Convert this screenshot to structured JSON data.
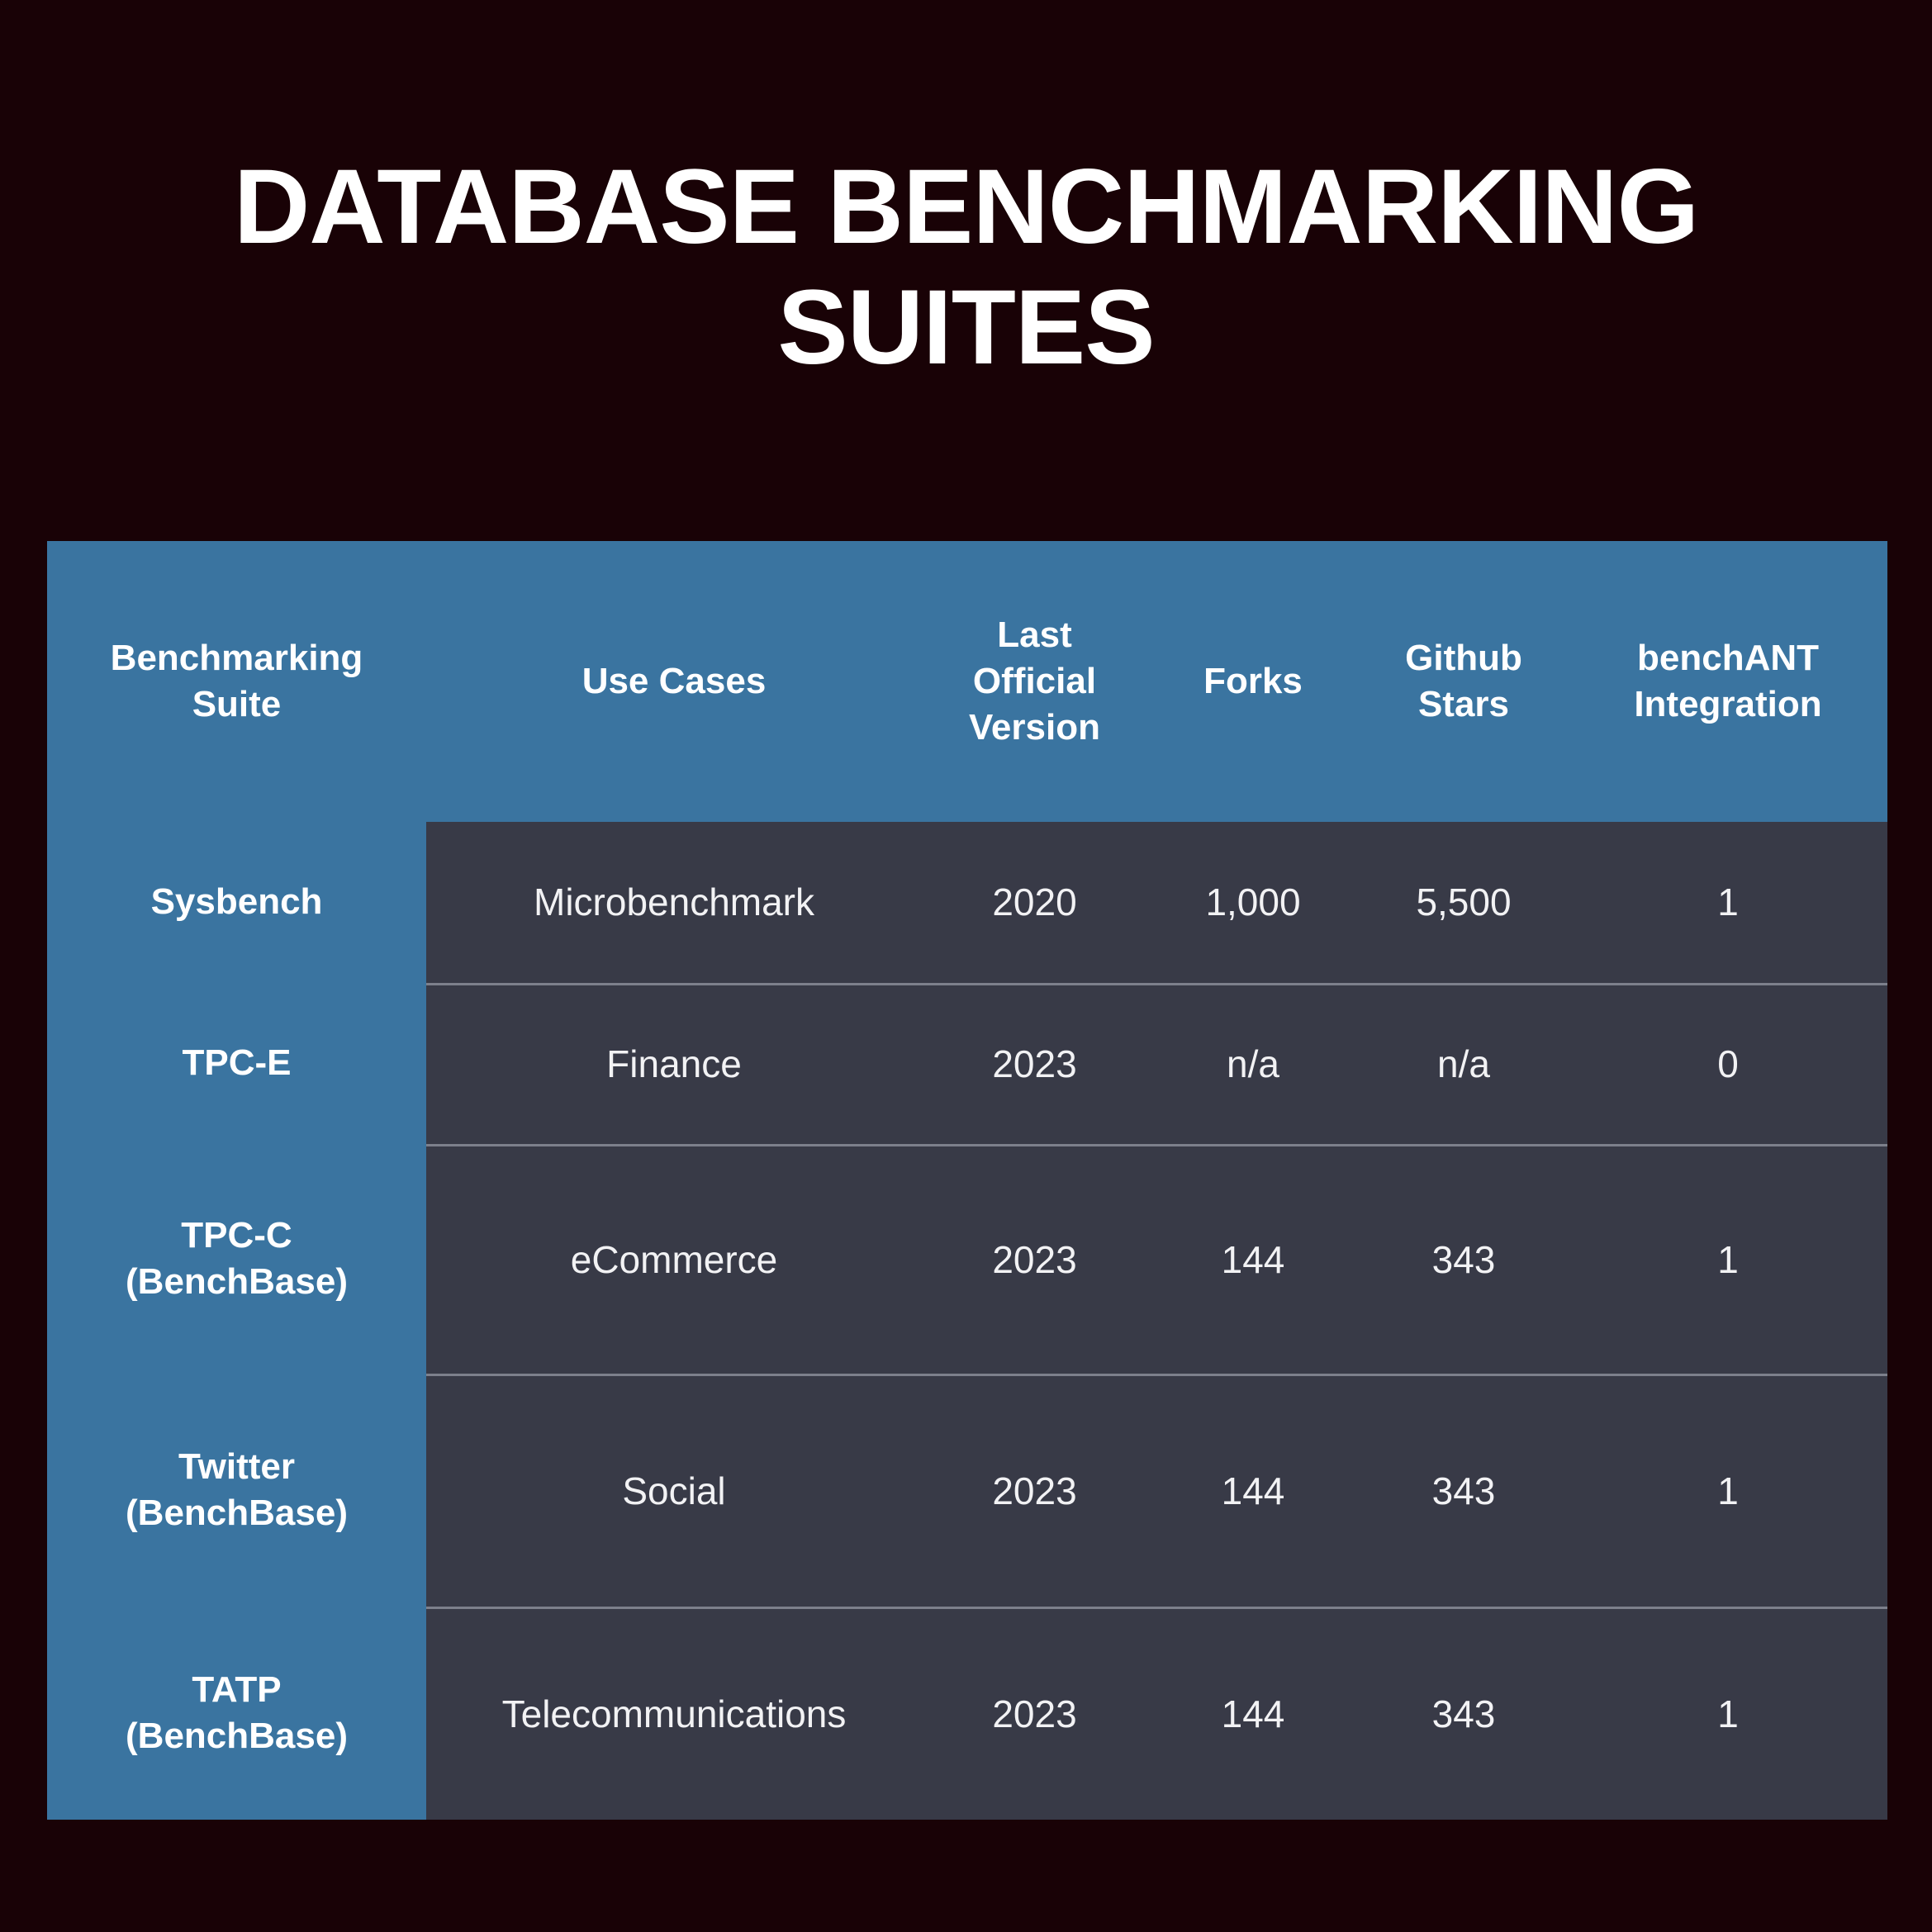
{
  "page": {
    "title": "DATABASE BENCHMARKING\nSUITES",
    "background_color": "#190206",
    "accent_color": "#3a74a0",
    "cell_color": "#383a47",
    "text_color": "#ffffff"
  },
  "table": {
    "columns": [
      "Benchmarking\nSuite",
      "Use Cases",
      "Last\nOfficial\nVersion",
      "Forks",
      "Github\nStars",
      "benchANT\nIntegration"
    ],
    "rows": [
      {
        "suite": "Sysbench",
        "use_cases": "Microbenchmark",
        "last_official_version": "2020",
        "forks": "1,000",
        "github_stars": "5,500",
        "benchant_integration": "1"
      },
      {
        "suite": "TPC-E",
        "use_cases": "Finance",
        "last_official_version": "2023",
        "forks": "n/a",
        "github_stars": "n/a",
        "benchant_integration": "0"
      },
      {
        "suite": "TPC-C\n(BenchBase)",
        "use_cases": "eCommerce",
        "last_official_version": "2023",
        "forks": "144",
        "github_stars": "343",
        "benchant_integration": "1"
      },
      {
        "suite": "Twitter\n(BenchBase)",
        "use_cases": "Social",
        "last_official_version": "2023",
        "forks": "144",
        "github_stars": "343",
        "benchant_integration": "1"
      },
      {
        "suite": "TATP\n(BenchBase)",
        "use_cases": "Telecommunications",
        "last_official_version": "2023",
        "forks": "144",
        "github_stars": "343",
        "benchant_integration": "1"
      }
    ]
  }
}
